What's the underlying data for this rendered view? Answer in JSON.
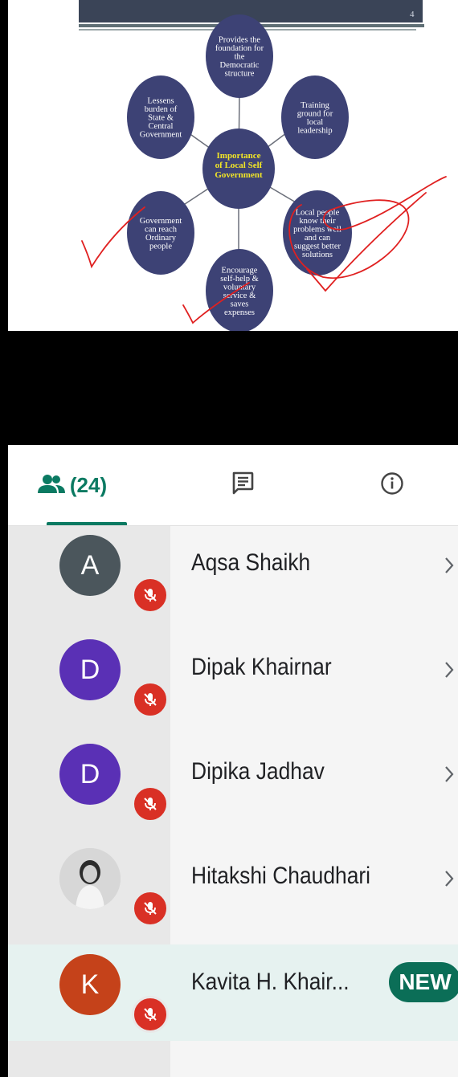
{
  "slide": {
    "page_number": "4",
    "center_bubble": [
      "Importance",
      "of Local Self",
      "Government"
    ],
    "bubbles": [
      [
        "Provides the",
        "foundation for",
        "the",
        "Democratic",
        "structure"
      ],
      [
        "Training",
        "ground for",
        "local",
        "leadership"
      ],
      [
        "Local people",
        "know their",
        "problems well",
        "and can",
        "suggest better",
        "solutions"
      ],
      [
        "Encourage",
        "self-help &",
        "voluntary",
        "service &",
        "saves",
        "expenses"
      ],
      [
        "Government",
        "can reach",
        "Ordinary",
        "people"
      ],
      [
        "Lessens",
        "burden of",
        "State &",
        "Central",
        "Government"
      ]
    ],
    "colors": {
      "bubble": "#3d4275",
      "center_text": "#f2e626",
      "annotation": "#e02020"
    }
  },
  "tabs": {
    "people_count": "(24)",
    "people_icon": "people-icon",
    "chat_icon": "chat-icon",
    "info_icon": "info-icon",
    "accent": "#0b7a62"
  },
  "participants": [
    {
      "initial": "A",
      "name": "Aqsa Shaikh",
      "avatar_color": "#4b565c",
      "muted": true
    },
    {
      "initial": "D",
      "name": "Dipak Khairnar",
      "avatar_color": "#5a30b5",
      "muted": true
    },
    {
      "initial": "D",
      "name": "Dipika Jadhav",
      "avatar_color": "#5a30b5",
      "muted": true
    },
    {
      "initial": "",
      "name": "Hitakshi Chaudhari",
      "avatar_color": "#d9d9d9",
      "muted": true,
      "photo": true
    },
    {
      "initial": "K",
      "name": "Kavita H. Khair...",
      "avatar_color": "#c5421a",
      "muted": true,
      "badge": "NEW"
    }
  ]
}
